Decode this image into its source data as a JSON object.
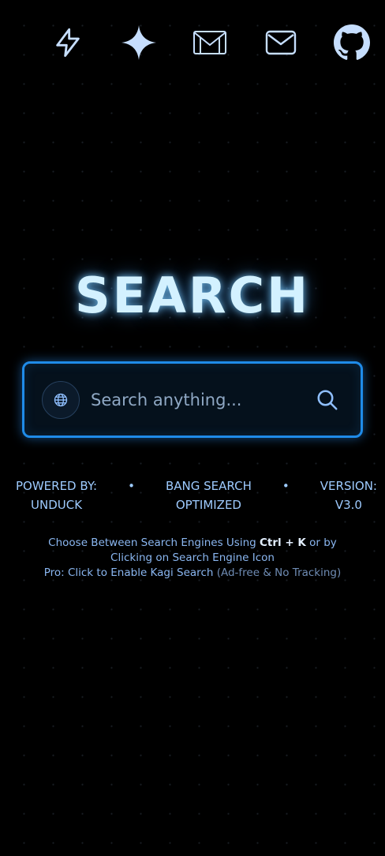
{
  "top_bar": {
    "icons": [
      "lightning-icon",
      "sparkle-icon",
      "gmail-icon",
      "mail-icon",
      "github-icon"
    ]
  },
  "title": "SEARCH",
  "search": {
    "placeholder": "Search anything...",
    "value": "",
    "engine_icon": "globe-icon",
    "submit_icon": "search-icon"
  },
  "info": {
    "powered_label": "POWERED BY:",
    "powered_value": "UNDUCK",
    "separator": "•",
    "bang_label": "BANG SEARCH",
    "bang_value": "OPTIMIZED",
    "version_label": "VERSION:",
    "version_value": "V3.0"
  },
  "hints": {
    "line1_prefix": "Choose Between Search Engines Using",
    "shortcut": "Ctrl + K",
    "line1_suffix": "or by",
    "line2": "Clicking on Search Engine Icon",
    "pro_text": "Pro: Click to Enable Kagi Search",
    "pro_note": "(Ad-free & No Tracking)"
  },
  "colors": {
    "background": "#000000",
    "accent": "#1f8be8",
    "title_glow": "#7dcdff",
    "text": "#9ecbff"
  }
}
